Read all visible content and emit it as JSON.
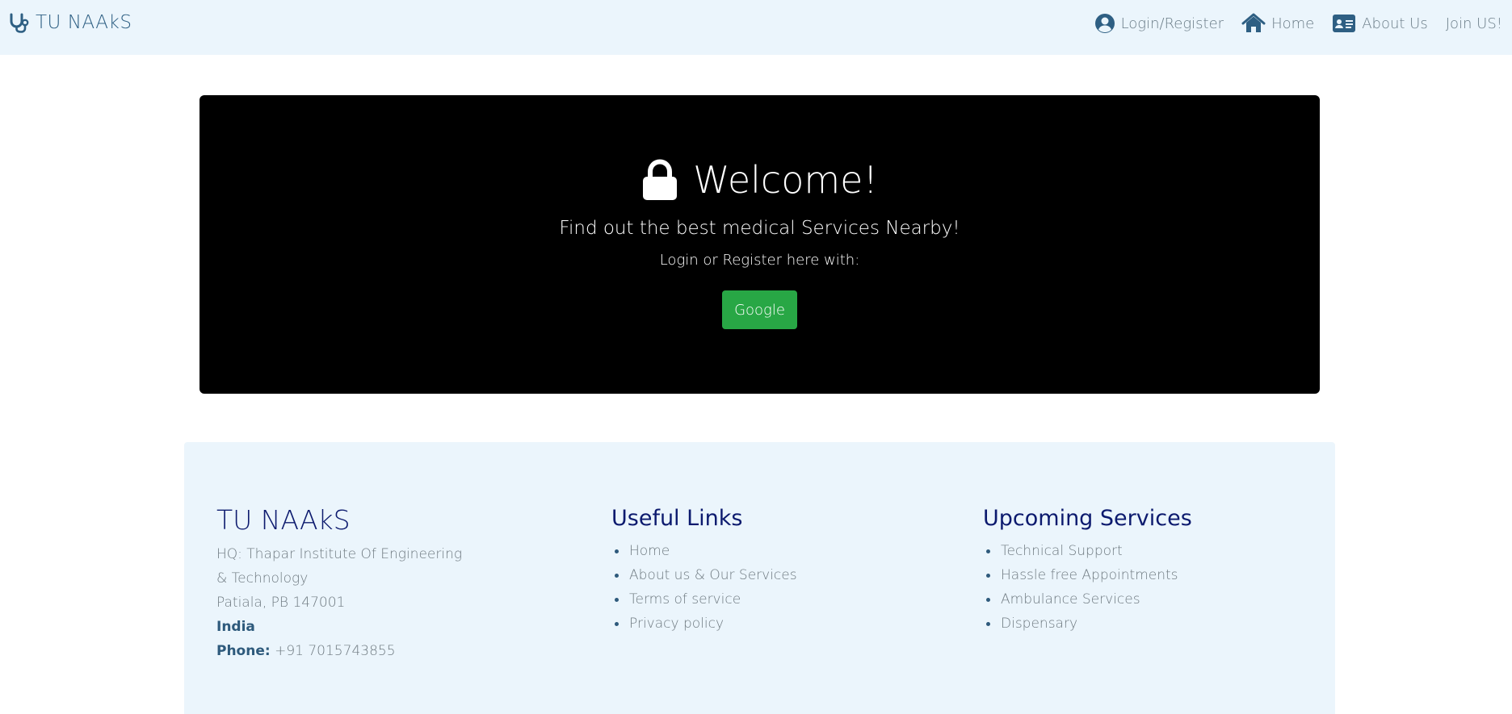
{
  "navbar": {
    "brand": {
      "icon": "stethoscope-icon",
      "text": "TU NAAkS"
    },
    "links": [
      {
        "label": "Login/Register",
        "icon": "user-circle-icon"
      },
      {
        "label": "Home",
        "icon": "home-icon"
      },
      {
        "label": "About Us",
        "icon": "id-card-icon"
      },
      {
        "label": "Join US!",
        "icon": ""
      }
    ]
  },
  "hero": {
    "icon": "lock-icon",
    "title": "Welcome!",
    "subtitle": "Find out the best medical Services Nearby!",
    "note": "Login or Register here with:",
    "google_button": "Google"
  },
  "footer": {
    "brand": "TU NAAkS",
    "address_lines": [
      "HQ: Thapar Institute Of Engineering",
      "& Technology",
      "Patiala, PB 147001"
    ],
    "country": "India",
    "phone_label": "Phone:",
    "phone_value": "+91 7015743855",
    "useful_links": {
      "heading": "Useful Links",
      "items": [
        "Home",
        "About us & Our Services",
        "Terms of service",
        "Privacy policy"
      ]
    },
    "upcoming_services": {
      "heading": "Upcoming Services",
      "items": [
        "Technical Support",
        "Hassle free Appointments",
        "Ambulance Services",
        "Dispensary"
      ]
    }
  },
  "colors": {
    "navbar_bg": "#ebf5fc",
    "brand": "#2e5f83",
    "hero_bg": "#000000",
    "button_green": "#28a745",
    "footer_heading": "#0c1a6e"
  }
}
